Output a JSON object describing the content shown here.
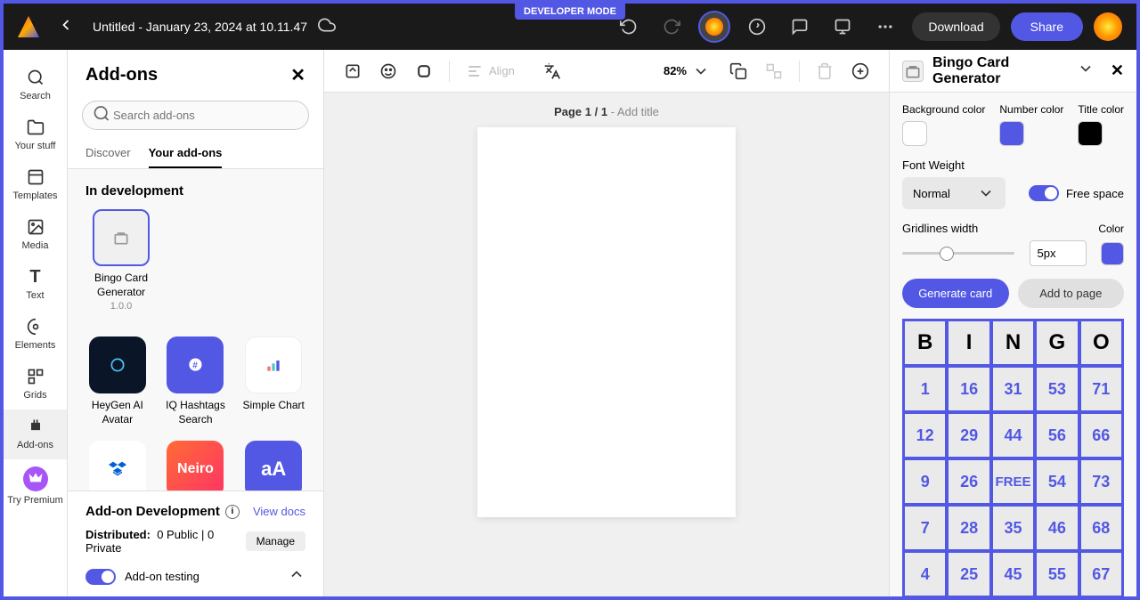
{
  "dev_mode": "DEVELOPER MODE",
  "topbar": {
    "title": "Untitled - January 23, 2024 at 10.11.47",
    "download": "Download",
    "share": "Share"
  },
  "leftbar": {
    "items": [
      "Search",
      "Your stuff",
      "Templates",
      "Media",
      "Text",
      "Elements",
      "Grids",
      "Add-ons",
      "Try Premium"
    ]
  },
  "addons_panel": {
    "title": "Add-ons",
    "search_placeholder": "Search add-ons",
    "tabs": {
      "discover": "Discover",
      "yours": "Your add-ons"
    },
    "dev_section": "In development",
    "dev_addon": {
      "name": "Bingo Card Generator",
      "version": "1.0.0"
    },
    "grid": [
      {
        "name": "HeyGen AI Avatar",
        "bg": "#0a1628"
      },
      {
        "name": "IQ Hashtags Search",
        "bg": "#5258E4"
      },
      {
        "name": "Simple Chart",
        "bg": "#ffffff"
      },
      {
        "name": "",
        "bg": "#0061D5"
      },
      {
        "name": "",
        "bg": "linear-gradient(135deg,#ff6b35,#ff3366)"
      },
      {
        "name": "",
        "bg": "#5258E4"
      }
    ],
    "footer": {
      "title": "Add-on Development",
      "view_docs": "View docs",
      "distributed_label": "Distributed:",
      "distributed_val": "0 Public | 0 Private",
      "manage": "Manage",
      "testing": "Add-on testing"
    }
  },
  "canvas": {
    "align": "Align",
    "zoom": "82%",
    "page_label": "Page 1 / 1",
    "add_title": " - Add title"
  },
  "right_panel": {
    "title": "Bingo Card Generator",
    "bg_color_label": "Background color",
    "bg_color": "#ffffff",
    "num_color_label": "Number color",
    "num_color": "#5258E4",
    "title_color_label": "Title color",
    "title_color": "#000000",
    "font_weight_label": "Font Weight",
    "font_weight": "Normal",
    "free_space": "Free space",
    "gridlines_label": "Gridlines width",
    "gridlines_value": "5px",
    "grid_color_label": "Color",
    "grid_color": "#5258E4",
    "generate": "Generate card",
    "add_page": "Add to page",
    "bingo": {
      "headers": [
        "B",
        "I",
        "N",
        "G",
        "O"
      ],
      "rows": [
        [
          "1",
          "16",
          "31",
          "53",
          "71"
        ],
        [
          "12",
          "29",
          "44",
          "56",
          "66"
        ],
        [
          "9",
          "26",
          "FREE",
          "54",
          "73"
        ],
        [
          "7",
          "28",
          "35",
          "46",
          "68"
        ],
        [
          "4",
          "25",
          "45",
          "55",
          "67"
        ]
      ]
    }
  }
}
